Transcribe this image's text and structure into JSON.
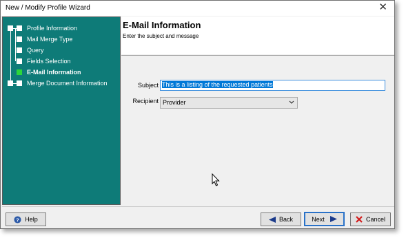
{
  "window": {
    "title": "New / Modify Profile Wizard",
    "close_glyph": "✕"
  },
  "steps": [
    {
      "label": "Profile Information",
      "active": false
    },
    {
      "label": "Mail Merge Type",
      "active": false
    },
    {
      "label": "Query",
      "active": false
    },
    {
      "label": "Fields Selection",
      "active": false
    },
    {
      "label": "E-Mail Information",
      "active": true
    },
    {
      "label": "Merge Document Information",
      "active": false
    }
  ],
  "header": {
    "title": "E-Mail Information",
    "subtitle": "Enter the subject and message"
  },
  "form": {
    "subject_label": "Subject",
    "subject_value": "This is a listing of the requested patients",
    "recipient_label": "Recipient",
    "recipient_value": "Provider"
  },
  "buttons": {
    "help": "Help",
    "back": "Back",
    "next": "Next",
    "cancel": "Cancel"
  },
  "colors": {
    "sidebar_bg": "#0e7b78",
    "active_step": "#2bd63a",
    "accent": "#2a72c8",
    "cancel_red": "#d21b1b"
  },
  "icons": {
    "help": "help-icon",
    "back": "arrow-left-icon",
    "next": "arrow-right-icon",
    "cancel": "cancel-x-icon",
    "close": "close-icon",
    "cursor": "mouse-cursor-icon"
  }
}
